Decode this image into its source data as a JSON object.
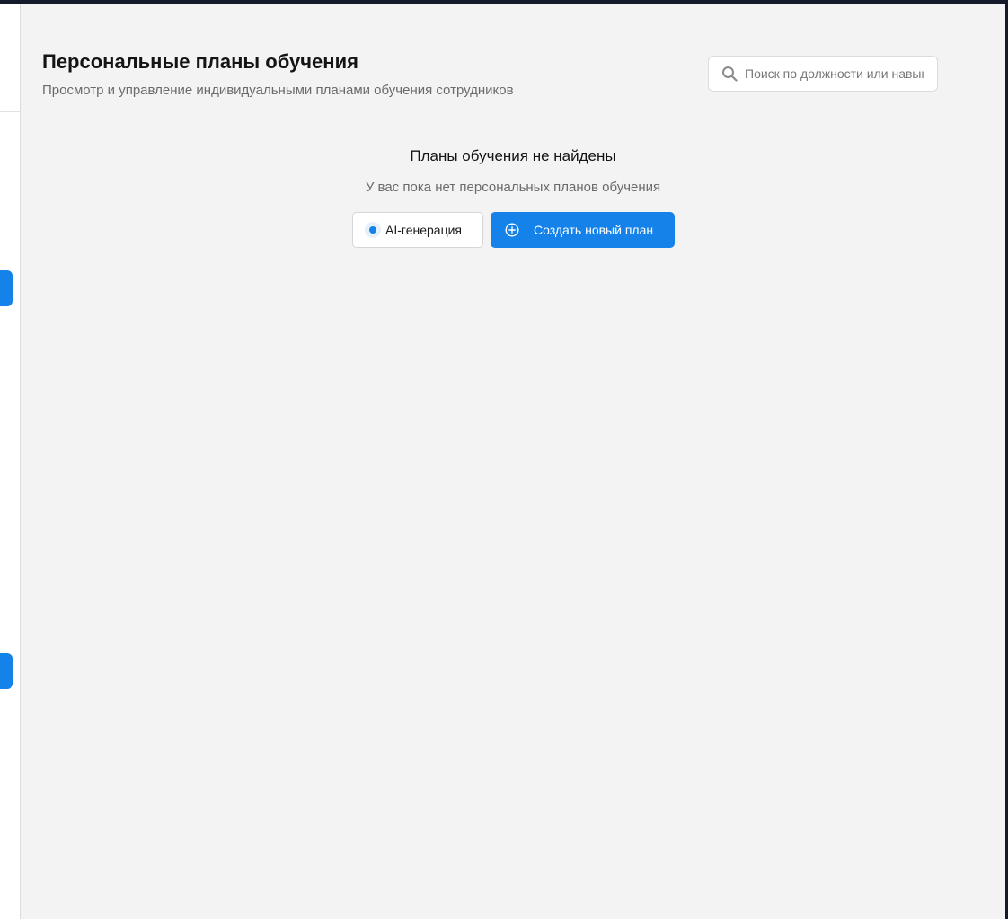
{
  "header": {
    "title": "Персональные планы обучения",
    "subtitle": "Просмотр и управление индивидуальными планами обучения сотрудников"
  },
  "search": {
    "placeholder": "Поиск по должности или навыкам",
    "icon": "search-icon"
  },
  "empty_state": {
    "title": "Планы обучения не найдены",
    "subtitle": "У вас пока нет персональных планов обучения"
  },
  "actions": {
    "ai_label": "AI-генерация",
    "create_label": "Создать новый план",
    "create_icon": "plus-circle-icon"
  },
  "colors": {
    "accent": "#1482e8",
    "background": "#f3f3f3",
    "title": "#141414",
    "muted": "#6a6a6a"
  }
}
